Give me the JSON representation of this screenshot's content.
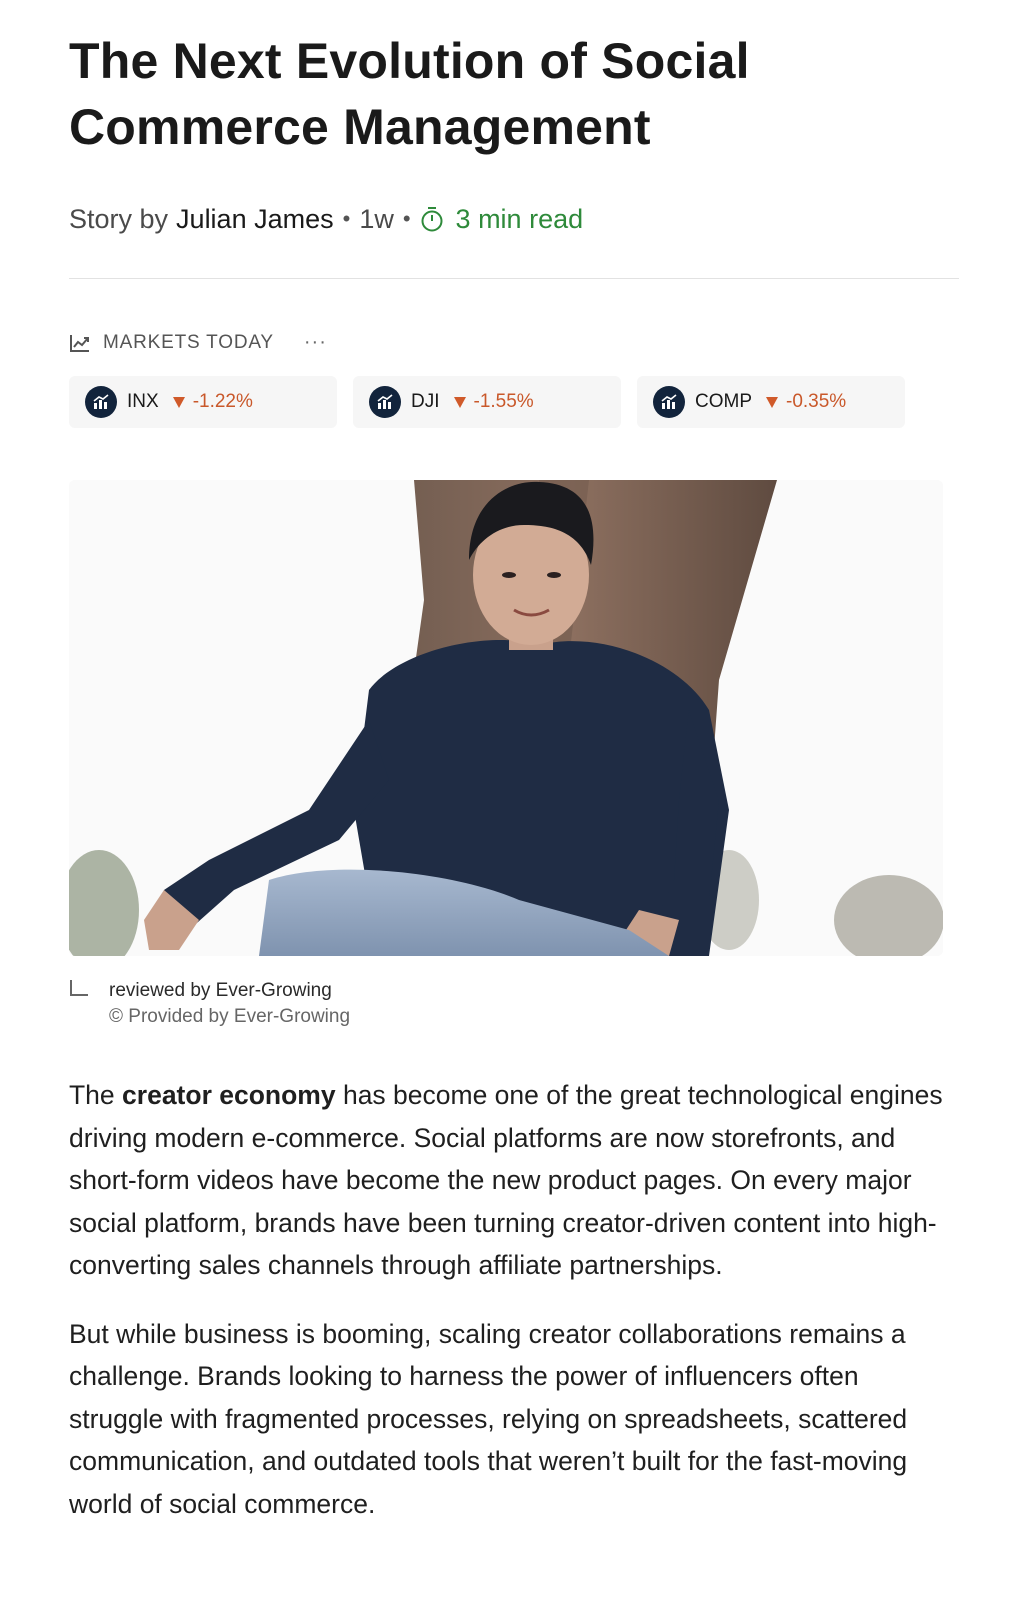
{
  "article": {
    "title": "The Next Evolution of Social Commerce Management",
    "byline": {
      "prefix": "Story by",
      "author": "Julian James",
      "age": "1w",
      "read_time": "3 min read",
      "separator": "•"
    }
  },
  "markets": {
    "heading": "MARKETS TODAY",
    "more": "···",
    "tickers": [
      {
        "symbol": "INX",
        "change": "-1.22%"
      },
      {
        "symbol": "DJI",
        "change": "-1.55%"
      },
      {
        "symbol": "COMP",
        "change": "-0.35%"
      }
    ]
  },
  "image_caption": {
    "line1": "reviewed by Ever-Growing",
    "line2": "© Provided by Ever-Growing"
  },
  "body": {
    "p1": {
      "pre": "The ",
      "bold": "creator economy",
      "post": " has become one of the great technological engines driving modern e-commerce. Social platforms are now storefronts, and short-form videos have become the new product pages. On every major social platform, brands have been turning creator-driven content into high-converting sales channels through affiliate partnerships."
    },
    "p2": "But while business is booming, scaling creator collaborations remains a challenge. Brands looking to harness the power of influencers often struggle with fragmented processes, relying on spreadsheets, scattered communication, and outdated tools that weren’t built for the fast-moving world of social commerce."
  },
  "colors": {
    "read_time": "#2e8a3a",
    "decline": "#c9582a",
    "ticker_logo": "#12243c"
  },
  "icons": {
    "timer": "stopwatch-icon",
    "markets": "chart-line-icon",
    "ticker_logo": "bar-chart-logo-icon",
    "caption": "corner-bracket-icon"
  }
}
